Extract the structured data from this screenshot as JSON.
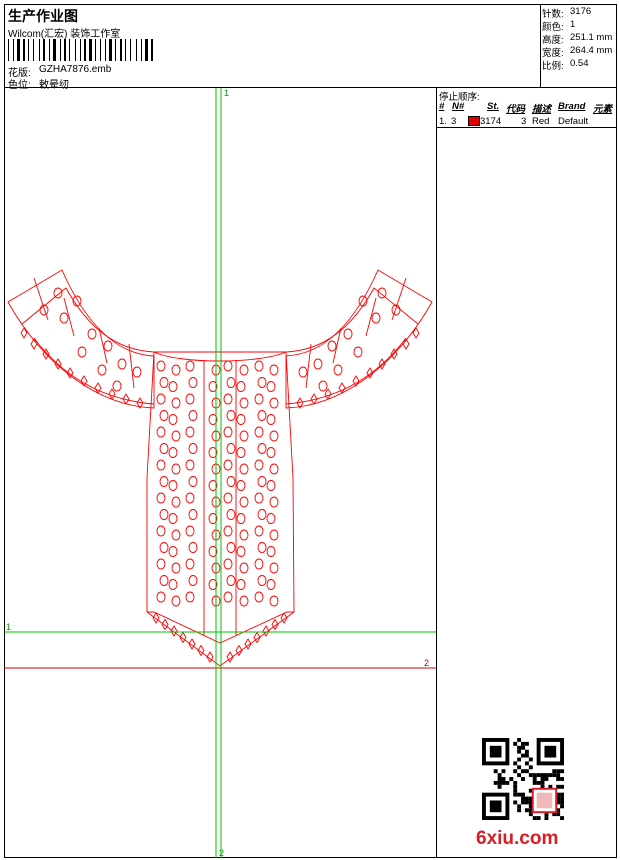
{
  "header": {
    "title": "生产作业图",
    "studio": "Wilcom(汇宏) 装饰工作室",
    "design_label": "花版:",
    "design_value": "GZHA7876.emb",
    "color_label": "色位:",
    "color_value": "敕晕纫"
  },
  "stats": [
    {
      "label": "针数:",
      "value": "3176"
    },
    {
      "label": "颜色:",
      "value": "1"
    },
    {
      "label": "高度:",
      "value": "251.1 mm"
    },
    {
      "label": "宽度:",
      "value": "264.4 mm"
    },
    {
      "label": "比例:",
      "value": "0.54"
    }
  ],
  "stop_sequence": {
    "title": "停止顺序:",
    "headers": [
      "#",
      "N#",
      "St.",
      "代码",
      "描述",
      "Brand",
      "元素"
    ],
    "rows": [
      {
        "index": "1.",
        "needle": "3",
        "stitches": "3174",
        "code": "3",
        "description": "Red",
        "brand": "Default",
        "swatch": "#e00000"
      }
    ]
  },
  "canvas": {
    "axis_labels": {
      "v_top": "1",
      "v_bottom": "2",
      "h_left": "1",
      "h_right": "2"
    },
    "guide_color": "#00c000",
    "design_color": "#ff0000",
    "red_line_color": "#d00000"
  },
  "watermark": "6xiu.com",
  "icons": [
    "barcode-icon",
    "qr-code-icon"
  ]
}
